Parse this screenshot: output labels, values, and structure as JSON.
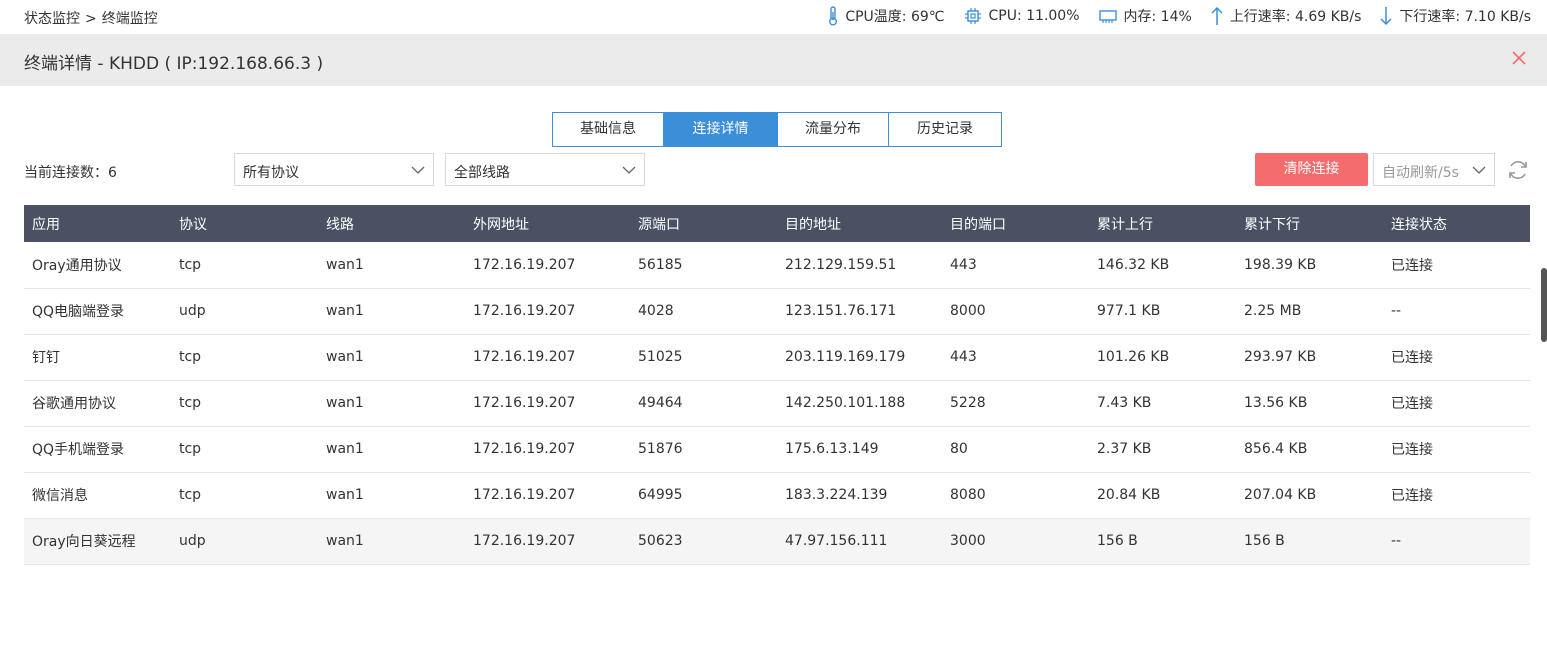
{
  "breadcrumb": {
    "parent": "状态监控",
    "separator": ">",
    "current": "终端监控"
  },
  "stats": {
    "cpu_temp": "CPU温度: 69℃",
    "cpu": "CPU: 11.00%",
    "memory": "内存: 14%",
    "upload": "上行速率: 4.69 KB/s",
    "download": "下行速率: 7.10 KB/s"
  },
  "header": {
    "title": "终端详情 - KHDD ( IP:192.168.66.3 )"
  },
  "tabs": [
    {
      "label": "基础信息"
    },
    {
      "label": "连接详情"
    },
    {
      "label": "流量分布"
    },
    {
      "label": "历史记录"
    }
  ],
  "toolbar": {
    "conn_count": "当前连接数：6",
    "protocol_select": "所有协议",
    "line_select": "全部线路",
    "clear_button": "清除连接",
    "refresh_select": "自动刷新/5s"
  },
  "table": {
    "columns": [
      "应用",
      "协议",
      "线路",
      "外网地址",
      "源端口",
      "目的地址",
      "目的端口",
      "累计上行",
      "累计下行",
      "连接状态"
    ],
    "rows": [
      [
        "Oray通用协议",
        "tcp",
        "wan1",
        "172.16.19.207",
        "56185",
        "212.129.159.51",
        "443",
        "146.32 KB",
        "198.39 KB",
        "已连接"
      ],
      [
        "QQ电脑端登录",
        "udp",
        "wan1",
        "172.16.19.207",
        "4028",
        "123.151.76.171",
        "8000",
        "977.1 KB",
        "2.25 MB",
        "--"
      ],
      [
        "钉钉",
        "tcp",
        "wan1",
        "172.16.19.207",
        "51025",
        "203.119.169.179",
        "443",
        "101.26 KB",
        "293.97 KB",
        "已连接"
      ],
      [
        "谷歌通用协议",
        "tcp",
        "wan1",
        "172.16.19.207",
        "49464",
        "142.250.101.188",
        "5228",
        "7.43 KB",
        "13.56 KB",
        "已连接"
      ],
      [
        "QQ手机端登录",
        "tcp",
        "wan1",
        "172.16.19.207",
        "51876",
        "175.6.13.149",
        "80",
        "2.37 KB",
        "856.4 KB",
        "已连接"
      ],
      [
        "微信消息",
        "tcp",
        "wan1",
        "172.16.19.207",
        "64995",
        "183.3.224.139",
        "8080",
        "20.84 KB",
        "207.04 KB",
        "已连接"
      ],
      [
        "Oray向日葵远程",
        "udp",
        "wan1",
        "172.16.19.207",
        "50623",
        "47.97.156.111",
        "3000",
        "156 B",
        "156 B",
        "--"
      ]
    ]
  },
  "colors": {
    "accent": "#3b8ed8",
    "danger": "#f46c6c",
    "table_header": "#4a5163"
  }
}
